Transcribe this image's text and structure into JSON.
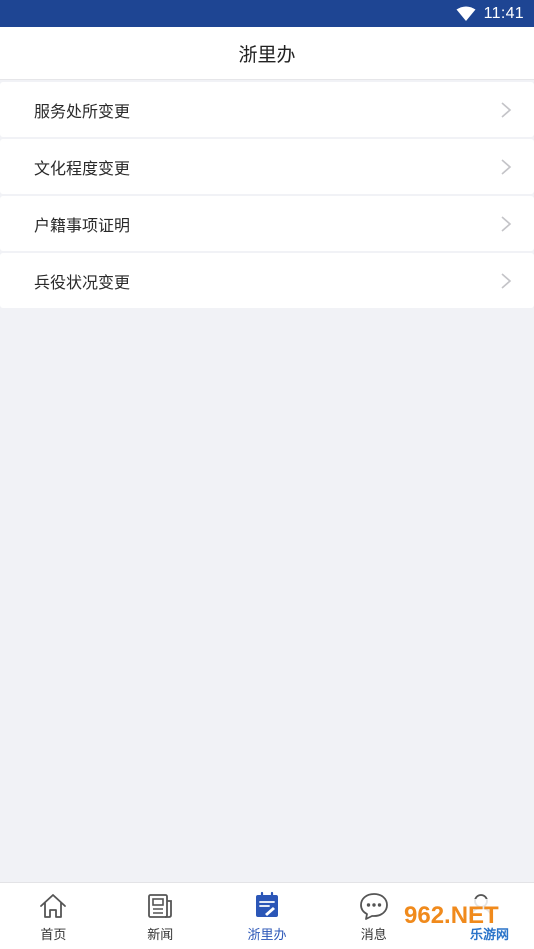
{
  "status_bar": {
    "time": "11:41"
  },
  "header": {
    "title": "浙里办"
  },
  "list": {
    "items": [
      {
        "label": "服务处所变更"
      },
      {
        "label": "文化程度变更"
      },
      {
        "label": "户籍事项证明"
      },
      {
        "label": "兵役状况变更"
      }
    ]
  },
  "tabbar": {
    "tabs": [
      {
        "label": "首页",
        "icon": "home-icon"
      },
      {
        "label": "新闻",
        "icon": "news-icon"
      },
      {
        "label": "浙里办",
        "icon": "services-icon",
        "active": true
      },
      {
        "label": "消息",
        "icon": "message-icon"
      },
      {
        "label": "",
        "icon": "profile-icon"
      }
    ]
  },
  "watermark": {
    "text": "962.NET",
    "subtext": "乐游网"
  },
  "colors": {
    "status_bar_bg": "#1e4593",
    "accent": "#2b56b7",
    "page_bg": "#f1f2f6"
  }
}
